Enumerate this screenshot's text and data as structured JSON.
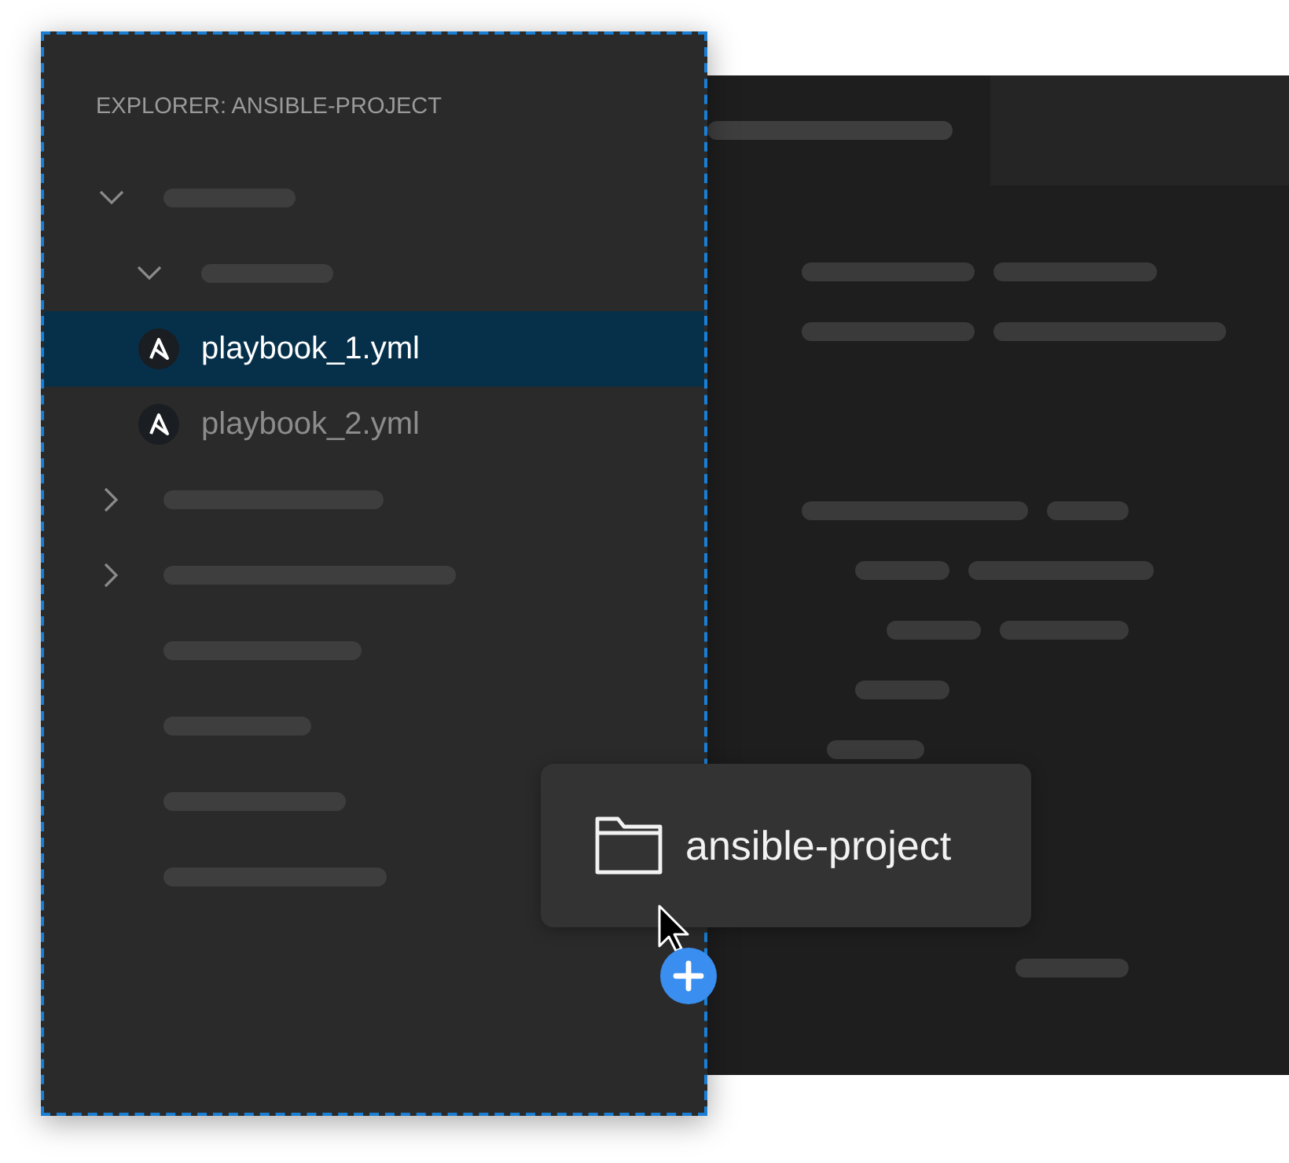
{
  "explorer": {
    "title": "EXPLORER: ANSIBLE-PROJECT",
    "tree": [
      {
        "kind": "folder",
        "expanded": true,
        "selected": false,
        "children": [
          {
            "kind": "folder",
            "expanded": true,
            "selected": false,
            "children": [
              {
                "kind": "file",
                "name": "playbook_1.yml",
                "selected": true
              },
              {
                "kind": "file",
                "name": "playbook_2.yml",
                "selected": false
              }
            ]
          }
        ]
      },
      {
        "kind": "folder",
        "expanded": false,
        "selected": false
      },
      {
        "kind": "folder",
        "expanded": false,
        "selected": false
      },
      {
        "kind": "item",
        "selected": false
      },
      {
        "kind": "item",
        "selected": false
      },
      {
        "kind": "item",
        "selected": false
      },
      {
        "kind": "item",
        "selected": false
      }
    ]
  },
  "drag_preview": {
    "label": "ansible-project"
  }
}
